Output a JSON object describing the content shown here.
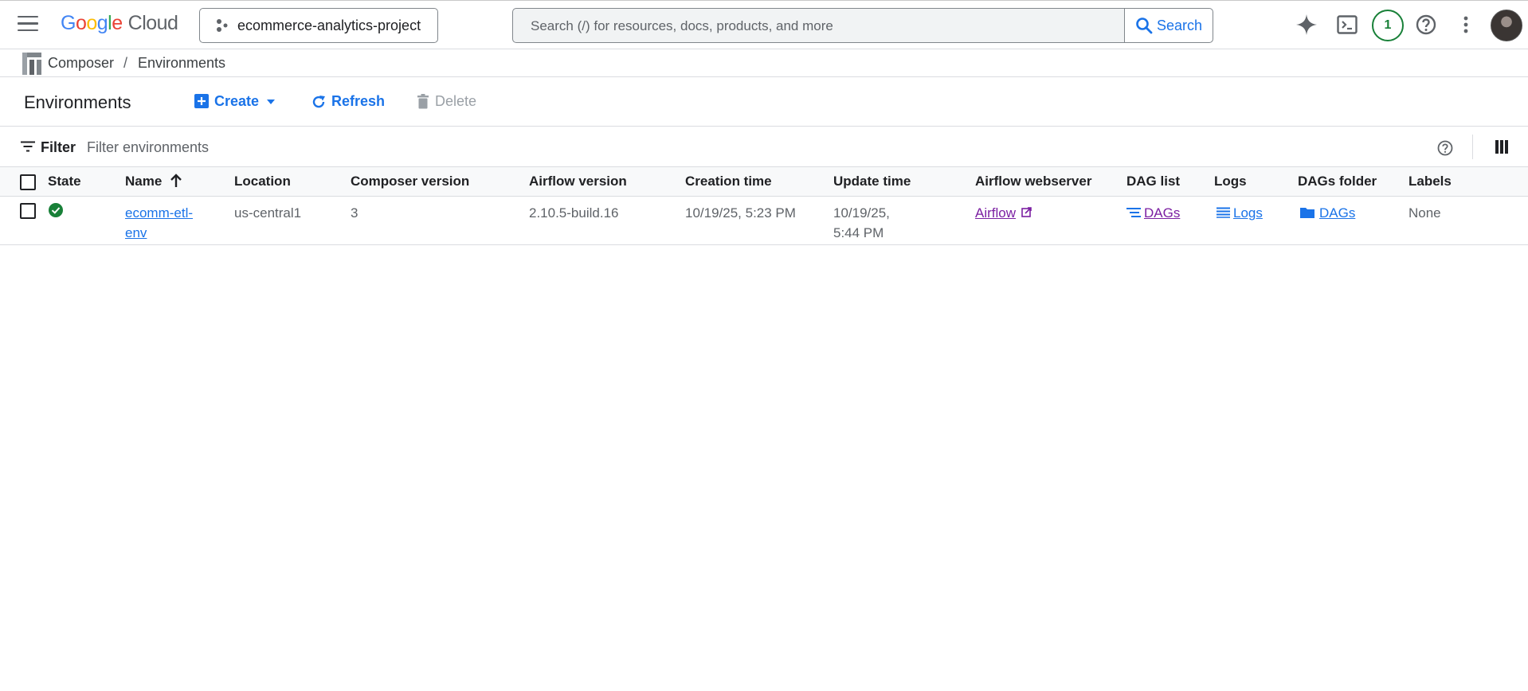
{
  "topbar": {
    "logo_main": "Google",
    "logo_product": "Cloud",
    "project_name": "ecommerce-analytics-project",
    "search_placeholder": "Search (/) for resources, docs, products, and more",
    "search_button": "Search",
    "notification_count": "1"
  },
  "breadcrumb": {
    "items": [
      "Composer",
      "Environments"
    ],
    "separator": "/"
  },
  "header": {
    "title": "Environments",
    "create_label": "Create",
    "refresh_label": "Refresh",
    "delete_label": "Delete"
  },
  "filter": {
    "label": "Filter",
    "placeholder": "Filter environments"
  },
  "table": {
    "columns": [
      "State",
      "Name",
      "Location",
      "Composer version",
      "Airflow version",
      "Creation time",
      "Update time",
      "Airflow webserver",
      "DAG list",
      "Logs",
      "DAGs folder",
      "Labels"
    ],
    "rows": [
      {
        "state": "running",
        "name_line1": "ecomm-etl-",
        "name_line2": "env",
        "location": "us-central1",
        "composer_version": "3",
        "airflow_version": "2.10.5-build.16",
        "creation_time": "10/19/25, 5:23 PM",
        "update_line1": "10/19/25,",
        "update_line2": "5:44 PM",
        "webserver_link": "Airflow",
        "dag_list_link": "DAGs",
        "logs_link": "Logs",
        "dags_folder_link": "DAGs",
        "labels": "None"
      }
    ]
  },
  "colors": {
    "accent": "#1a73e8",
    "success": "#188038",
    "visited_link": "#7b1fa2"
  }
}
